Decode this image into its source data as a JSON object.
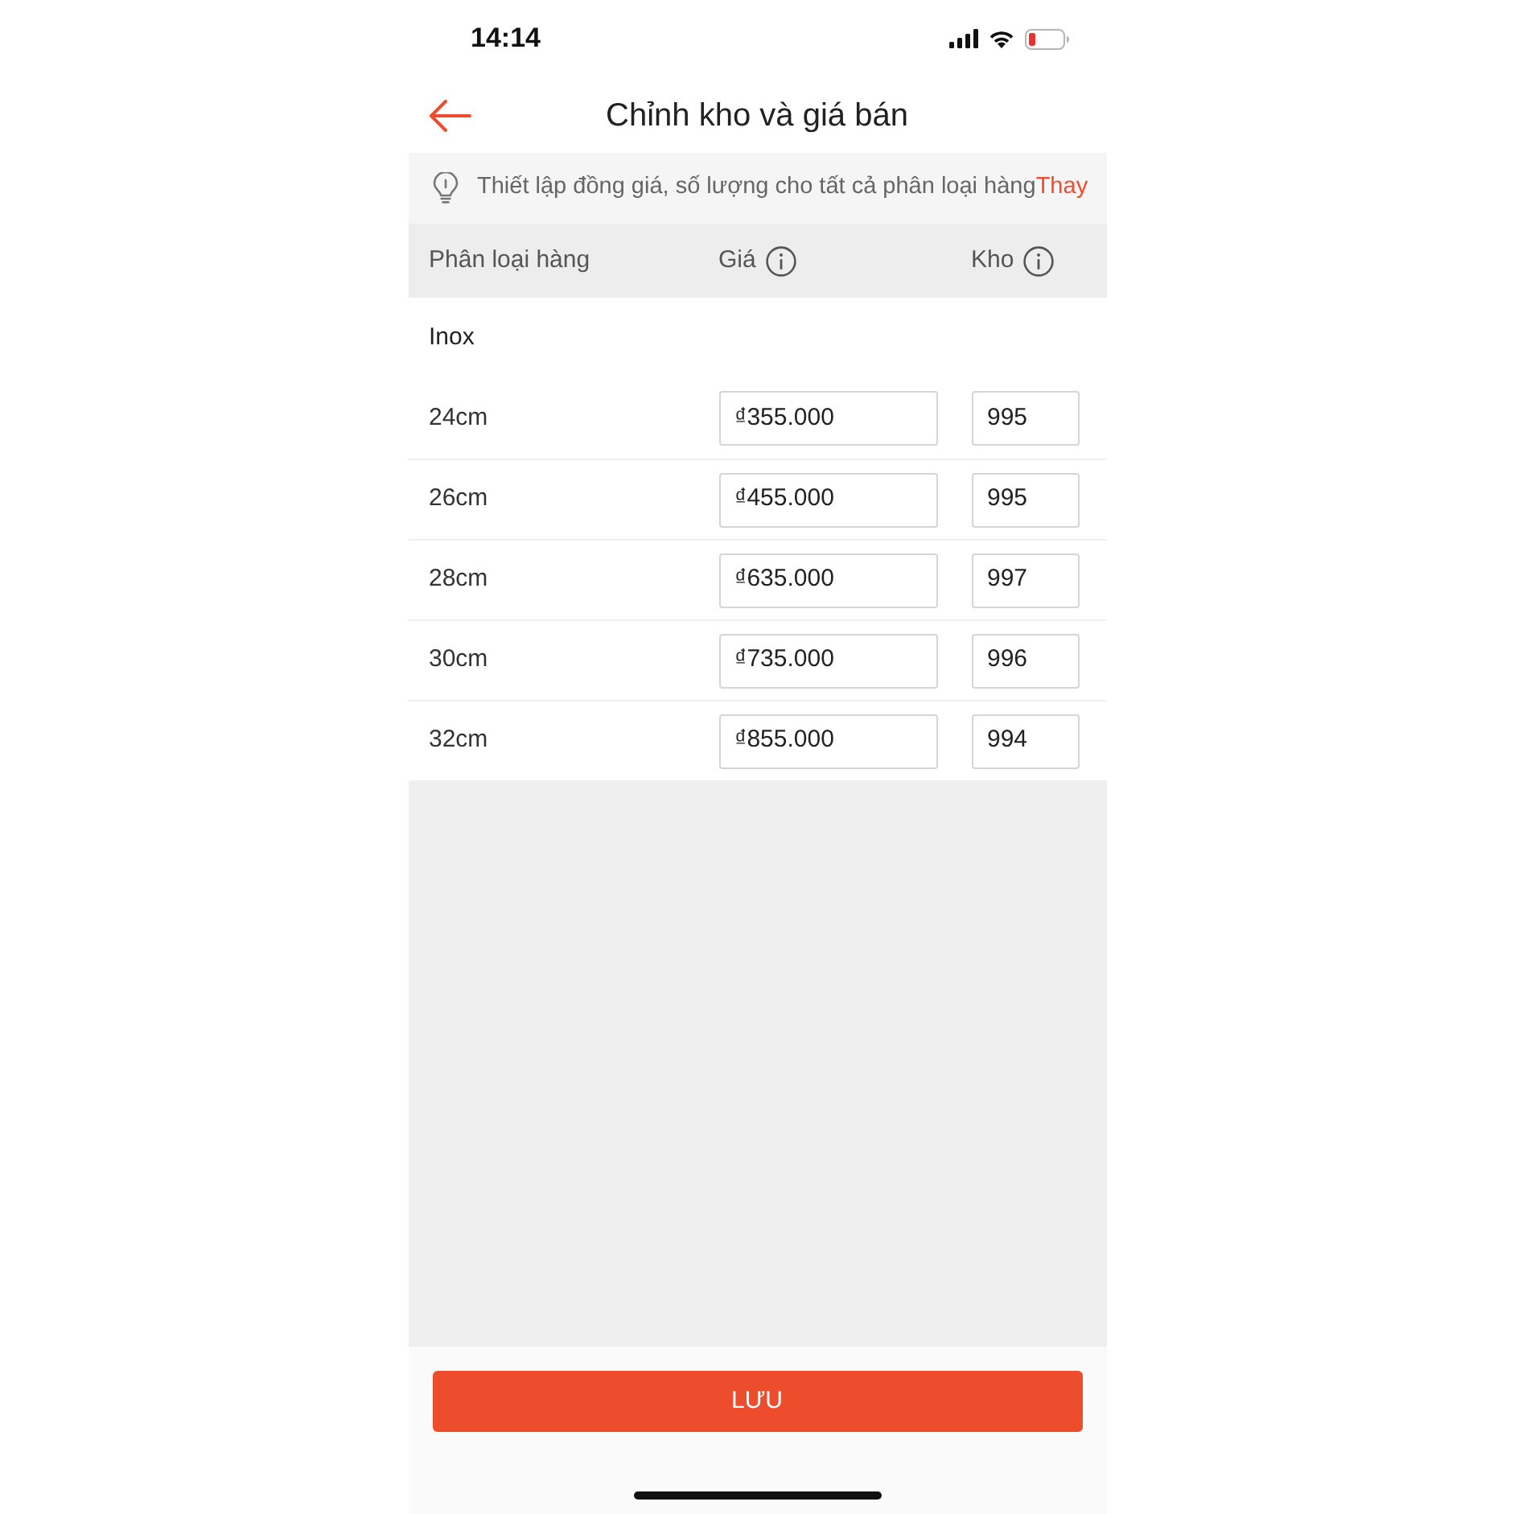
{
  "status_bar": {
    "time": "14:14"
  },
  "header": {
    "title": "Chỉnh kho và giá bán"
  },
  "banner": {
    "text": "Thiết lập đồng giá, số lượng cho tất cả phân loại hàng",
    "link": "Thay"
  },
  "table": {
    "columns": [
      {
        "label": "Phân loại hàng",
        "info": false
      },
      {
        "label": "Giá",
        "info": true
      },
      {
        "label": "Kho",
        "info": true
      }
    ],
    "groups": [
      {
        "name": "Inox",
        "rows": [
          {
            "variant": "24cm",
            "price": "₫355.000",
            "stock": "995"
          },
          {
            "variant": "26cm",
            "price": "₫455.000",
            "stock": "995"
          },
          {
            "variant": "28cm",
            "price": "₫635.000",
            "stock": "997"
          },
          {
            "variant": "30cm",
            "price": "₫735.000",
            "stock": "996"
          },
          {
            "variant": "32cm",
            "price": "₫855.000",
            "stock": "994"
          }
        ]
      }
    ]
  },
  "save_button": {
    "label": "LƯU"
  }
}
